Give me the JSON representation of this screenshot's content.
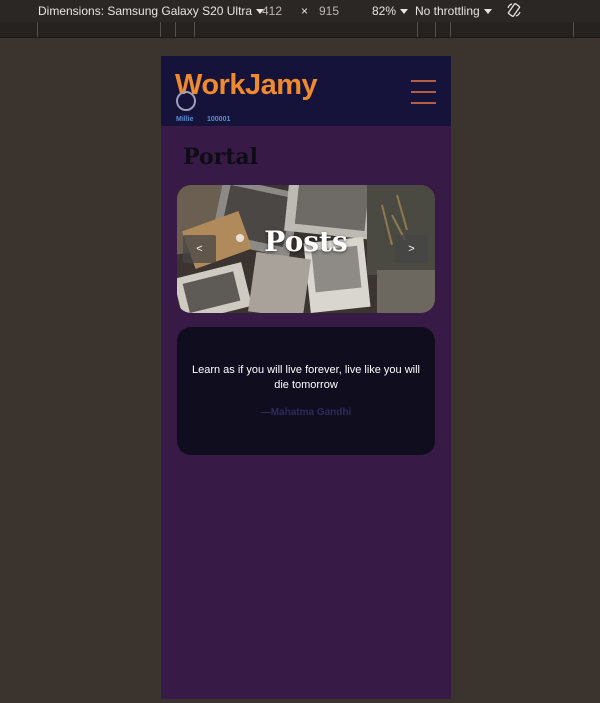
{
  "devtools": {
    "device_label": "Dimensions: Samsung Galaxy S20 Ultra",
    "width": "412",
    "times": "×",
    "height": "915",
    "zoom": "82%",
    "throttling": "No throttling"
  },
  "header": {
    "logo": "WorkJamy",
    "user_name": "Millie",
    "user_id": "100001"
  },
  "page": {
    "title": "Portal"
  },
  "carousel": {
    "title": "Posts",
    "prev": "<",
    "next": ">"
  },
  "quote": {
    "text": "Learn as if you will live forever, live like you will die tomorrow",
    "author": "—Mahatma Gandhi"
  },
  "colors": {
    "app_background": "#371a45",
    "header_background": "#15133a",
    "logo": "#f08a2e",
    "card_background": "#0f0d1e"
  },
  "icons": {
    "menu": "hamburger-icon",
    "avatar": "user-circle-icon",
    "rotate": "rotate-device-icon"
  }
}
